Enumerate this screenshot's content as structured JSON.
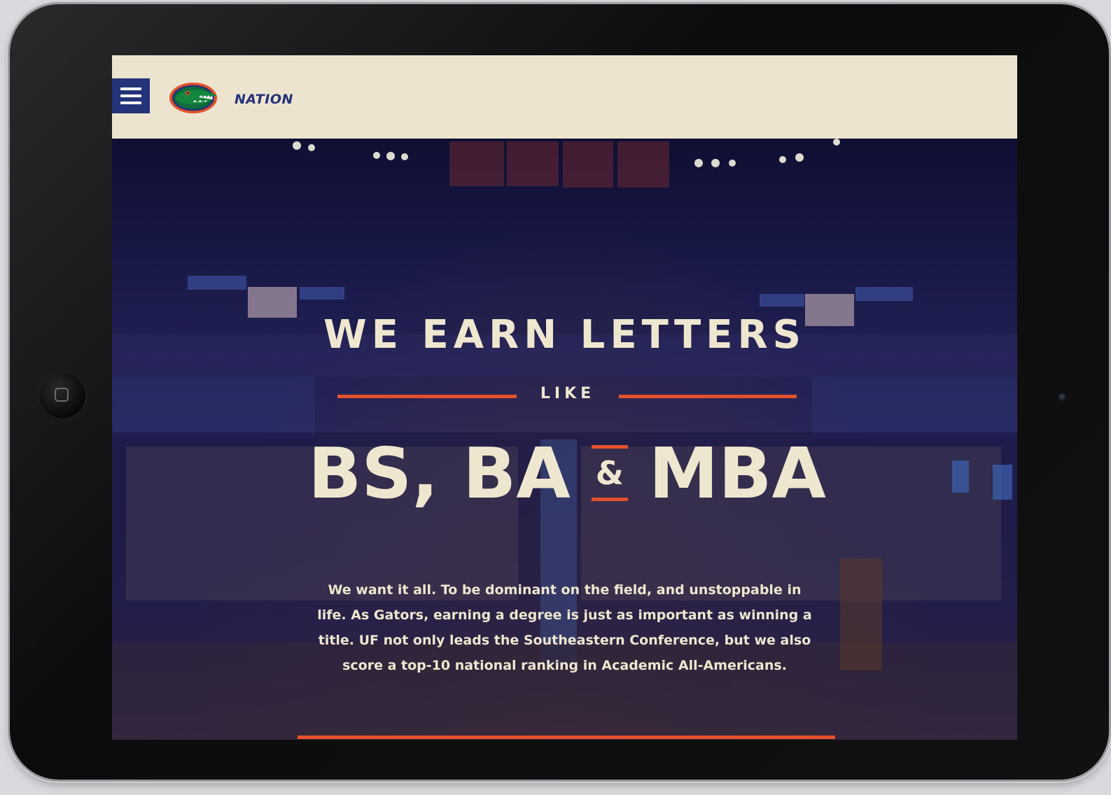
{
  "header": {
    "menu_icon": "hamburger-menu-icon",
    "logo_icon": "gator-logo-icon",
    "brand": "NATION"
  },
  "hero": {
    "headline": "WE EARN LETTERS",
    "connector": "LIKE",
    "degrees": {
      "first": "BS, BA",
      "amp": "&",
      "last": "MBA"
    },
    "body": "We want it all. To be dominant on the field, and unstoppable in life. As Gators, earning a degree is just as important as winning a title. UF not only leads the Southeastern Conference, but we also score a top-10 national ranking in Academic All-Americans.",
    "carousel": {
      "total": 2,
      "active_index": 1
    }
  },
  "colors": {
    "accent_orange": "#e4512a",
    "brand_blue": "#24337a",
    "cream": "#efe6cf",
    "header_bg": "#ece4cf",
    "hero_bg": "#1d1c4c"
  }
}
